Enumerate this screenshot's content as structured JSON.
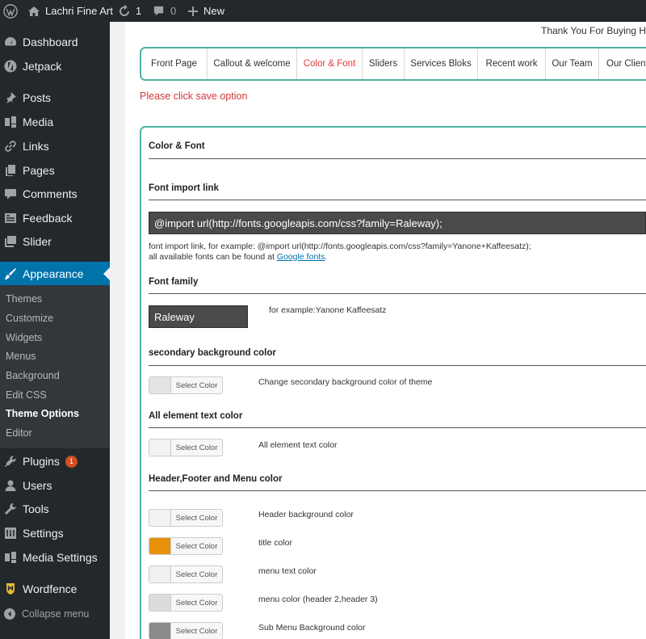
{
  "adminbar": {
    "site_name": "Lachri Fine Art",
    "updates_count": "1",
    "comments_count": "0",
    "new_label": "New"
  },
  "sidebar": {
    "items": [
      {
        "label": "Dashboard",
        "icon": "dashboard-icon"
      },
      {
        "label": "Jetpack",
        "icon": "jetpack-icon"
      },
      {
        "label": "Posts",
        "icon": "pin-icon"
      },
      {
        "label": "Media",
        "icon": "media-icon"
      },
      {
        "label": "Links",
        "icon": "link-icon"
      },
      {
        "label": "Pages",
        "icon": "pages-icon"
      },
      {
        "label": "Comments",
        "icon": "comment-icon"
      },
      {
        "label": "Feedback",
        "icon": "feedback-icon"
      },
      {
        "label": "Slider",
        "icon": "slider-icon"
      },
      {
        "label": "Appearance",
        "icon": "brush-icon"
      }
    ],
    "submenu": [
      "Themes",
      "Customize",
      "Widgets",
      "Menus",
      "Background",
      "Edit CSS",
      "Theme Options",
      "Editor"
    ],
    "lower_items": [
      {
        "label": "Plugins",
        "icon": "plugin-icon",
        "badge": "1"
      },
      {
        "label": "Users",
        "icon": "user-icon"
      },
      {
        "label": "Tools",
        "icon": "wrench-icon"
      },
      {
        "label": "Settings",
        "icon": "settings-icon"
      },
      {
        "label": "Media Settings",
        "icon": "media-icon"
      },
      {
        "label": "Wordfence",
        "icon": "wordfence-icon"
      }
    ],
    "collapse_label": "Collapse menu"
  },
  "header": {
    "thanks": "Thank You For Buying Ha"
  },
  "tabs": [
    "Front Page",
    "Callout & welcome",
    "Color & Font",
    "Sliders",
    "Services Bloks",
    "Recent work",
    "Our Team",
    "Our Client"
  ],
  "active_tab": "Color & Font",
  "notice": "Please click save option",
  "panel": {
    "title": "Color & Font",
    "font_import": {
      "label": "Font import link",
      "value": "@import url(http://fonts.googleapis.com/css?family=Raleway);",
      "help1": "font import link, for example: @import url(http://fonts.googleapis.com/css?family=Yanone+Kaffeesatz);",
      "help2_prefix": "all available fonts can be found at ",
      "help2_link": "Google fonts",
      "help2_suffix": "."
    },
    "font_family": {
      "label": "Font family",
      "value": "Raleway",
      "help": "for example:Yanone Kaffeesatz"
    },
    "sections": [
      {
        "title": "secondary background color",
        "options": [
          {
            "desc": "Change secondary background color of theme",
            "swatch": "#e4e4e4"
          }
        ]
      },
      {
        "title": "All element text color",
        "options": [
          {
            "desc": "All element text color",
            "swatch": "#f2f2f2"
          }
        ]
      },
      {
        "title": "Header,Footer and Menu color",
        "options": [
          {
            "desc": "Header background color",
            "swatch": "#f2f2f2"
          },
          {
            "desc": "title color",
            "swatch": "#e8920c"
          },
          {
            "desc": "menu text color",
            "swatch": "#f0f0f0"
          },
          {
            "desc": "menu color (header 2,header 3)",
            "swatch": "#dcdcdc"
          },
          {
            "desc": "Sub Menu Background color",
            "swatch": "#8a8a8a"
          }
        ]
      }
    ],
    "select_color_label": "Select Color"
  }
}
